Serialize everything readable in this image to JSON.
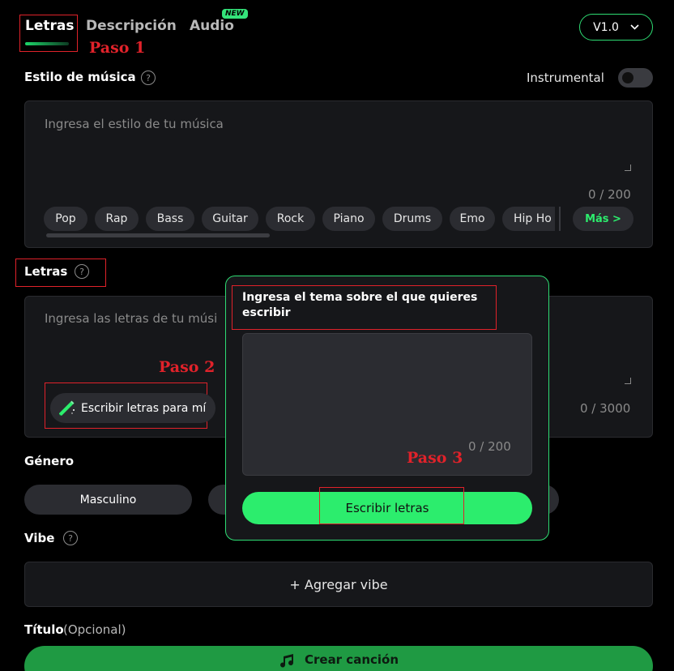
{
  "tabs": {
    "lyrics": "Letras",
    "description": "Descripción",
    "audio": "Audio",
    "audio_badge": "NEW"
  },
  "version": {
    "label": "V1.0"
  },
  "annotations": {
    "step1": "Paso 1",
    "step2": "Paso 2",
    "step3": "Paso 3"
  },
  "style_section": {
    "label": "Estilo de música",
    "instrumental_label": "Instrumental",
    "placeholder": "Ingresa el estilo de tu música",
    "counter": "0 / 200",
    "chips": [
      "Pop",
      "Rap",
      "Bass",
      "Guitar",
      "Rock",
      "Piano",
      "Drums",
      "Emo",
      "Hip Ho"
    ],
    "more": "Más >"
  },
  "lyrics_section": {
    "label": "Letras",
    "placeholder": "Ingresa las letras de tu músi",
    "write_for_me": "Escribir letras para mí",
    "counter": "0 / 3000"
  },
  "gender_section": {
    "label": "Género",
    "options": [
      "Masculino"
    ]
  },
  "vibe_section": {
    "label": "Vibe",
    "add_button": "+ Agregar vibe"
  },
  "title_section": {
    "label": "Título",
    "optional": "(Opcional)"
  },
  "create_button": "Crear canción",
  "modal": {
    "prompt": "Ingresa el tema sobre el que quieres escribir",
    "counter": "0 / 200",
    "submit": "Escribir letras"
  },
  "colors": {
    "accent": "#2ced6d",
    "annotation": "#e0222a",
    "create_button": "#1f9a43"
  }
}
